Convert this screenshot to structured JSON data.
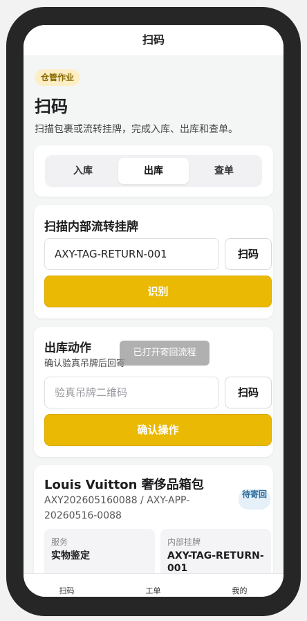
{
  "header": {
    "title": "扫码"
  },
  "page": {
    "tag": "仓管作业",
    "title": "扫码",
    "subtitle": "扫描包裹或流转挂牌，完成入库、出库和查单。"
  },
  "mode_tabs": [
    {
      "label": "入库",
      "active": false
    },
    {
      "label": "出库",
      "active": true
    },
    {
      "label": "查单",
      "active": false
    }
  ],
  "tag_scan": {
    "title": "扫描内部流转挂牌",
    "input_value": "AXY-TAG-RETURN-001",
    "scan_label": "扫码",
    "submit_label": "识别"
  },
  "toast": "已打开寄回流程",
  "outbound": {
    "title": "出库动作",
    "desc": "确认验真吊牌后回寄",
    "input_placeholder": "验真吊牌二维码",
    "scan_label": "扫码",
    "submit_label": "确认操作"
  },
  "order": {
    "title": "Louis Vuitton 奢侈品箱包",
    "subtitle": "AXY202605160088 / AXY-APP-20260516-0088",
    "status": "待寄回",
    "service_label": "服务",
    "service_value": "实物鉴定",
    "tag_label": "内部挂牌",
    "tag_value": "AXY-TAG-RETURN-001"
  },
  "tabbar": [
    {
      "label": "扫码"
    },
    {
      "label": "工单"
    },
    {
      "label": "我的"
    }
  ],
  "colors": {
    "accent": "#eab904",
    "tag_bg": "#fcefc6",
    "status_bg": "#e5f0f8"
  }
}
